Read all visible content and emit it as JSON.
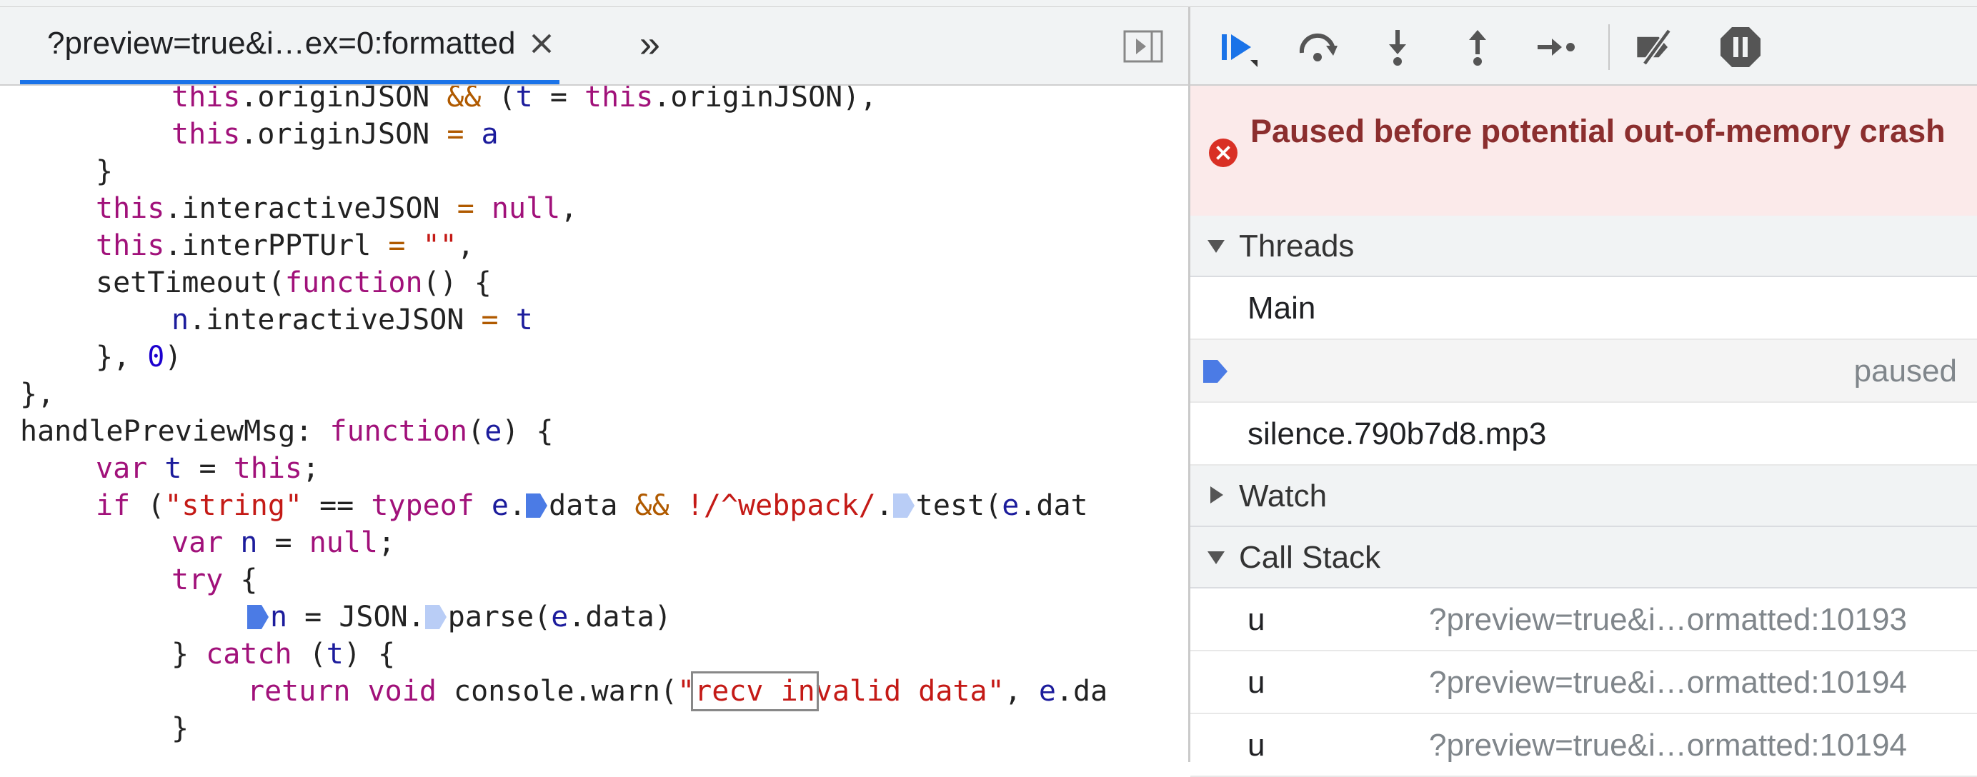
{
  "editor": {
    "tab_label": "?preview=true&i…ex=0:formatted",
    "more_tabs_glyph": "»"
  },
  "code": {
    "l1": {
      "a": "this",
      "b": ".originJSON ",
      "c": "&&",
      "d": " (",
      "e": "t",
      "f": " = ",
      "g": "this",
      "h": ".originJSON),"
    },
    "l2": {
      "a": "this",
      "b": ".originJSON ",
      "c": "=",
      "d": " ",
      "e": "a"
    },
    "l3": {
      "a": "}"
    },
    "l4": {
      "a": "this",
      "b": ".interactiveJSON ",
      "c": "=",
      "d": " ",
      "e": "null",
      "f": ","
    },
    "l5": {
      "a": "this",
      "b": ".interPPTUrl ",
      "c": "=",
      "d": " ",
      "e": "\"\"",
      "f": ","
    },
    "l6": {
      "a": "setTimeout(",
      "b": "function",
      "c": "() {"
    },
    "l7": {
      "a": "n",
      "b": ".interactiveJSON ",
      "c": "=",
      "d": " ",
      "e": "t"
    },
    "l8": {
      "a": "}, ",
      "b": "0",
      "c": ")"
    },
    "l9": {
      "a": "},"
    },
    "l10": {
      "a": "handlePreviewMsg: ",
      "b": "function",
      "c": "(",
      "d": "e",
      "e": ") {"
    },
    "l11": {
      "a": "var",
      "b": " ",
      "c": "t",
      "d": " = ",
      "e": "this",
      "f": ";"
    },
    "l12": {
      "a": "if",
      "b": " (",
      "c": "\"string\"",
      "d": " == ",
      "e": "typeof",
      "f": " ",
      "g": "e",
      "h": ".",
      "i": "data ",
      "j": "&&",
      "k": " ",
      "l": "!/^webpack/",
      "m": ".",
      "n": "test(",
      "o": "e",
      "p": ".dat"
    },
    "l13": {
      "a": "var",
      "b": " ",
      "c": "n",
      "d": " = ",
      "e": "null",
      "f": ";"
    },
    "l14": {
      "a": "try",
      "b": " {"
    },
    "l15": {
      "a": "n",
      "b": " = JSON.",
      "c": "parse(",
      "d": "e",
      "e": ".data)"
    },
    "l16": {
      "a": "} ",
      "b": "catch",
      "c": " (",
      "d": "t",
      "e": ") {"
    },
    "l17": {
      "a": "return",
      "b": " ",
      "c": "void",
      "d": " console.warn(",
      "e": "\"",
      "f": "recv in",
      "g": "valid data\"",
      "h": ", ",
      "i": "e",
      "j": ".da"
    },
    "l18": {
      "a": "}"
    }
  },
  "debugger": {
    "paused_message": "Paused before potential out-of-memory crash",
    "threads": {
      "title": "Threads",
      "items": [
        {
          "name": "Main",
          "status": ""
        },
        {
          "name": "",
          "status": "paused"
        },
        {
          "name": "silence.790b7d8.mp3",
          "status": ""
        }
      ]
    },
    "watch": {
      "title": "Watch"
    },
    "call_stack": {
      "title": "Call Stack",
      "frames": [
        {
          "fn": "u",
          "location": "?preview=true&i…ormatted:10193"
        },
        {
          "fn": "u",
          "location": "?preview=true&i…ormatted:10194"
        },
        {
          "fn": "u",
          "location": "?preview=true&i…ormatted:10194"
        }
      ]
    }
  },
  "colors": {
    "accent": "#1a73e8",
    "error": "#d93025",
    "paused_bg": "#fbeaea",
    "keyword": "#a1117a",
    "string": "#c41a16"
  }
}
